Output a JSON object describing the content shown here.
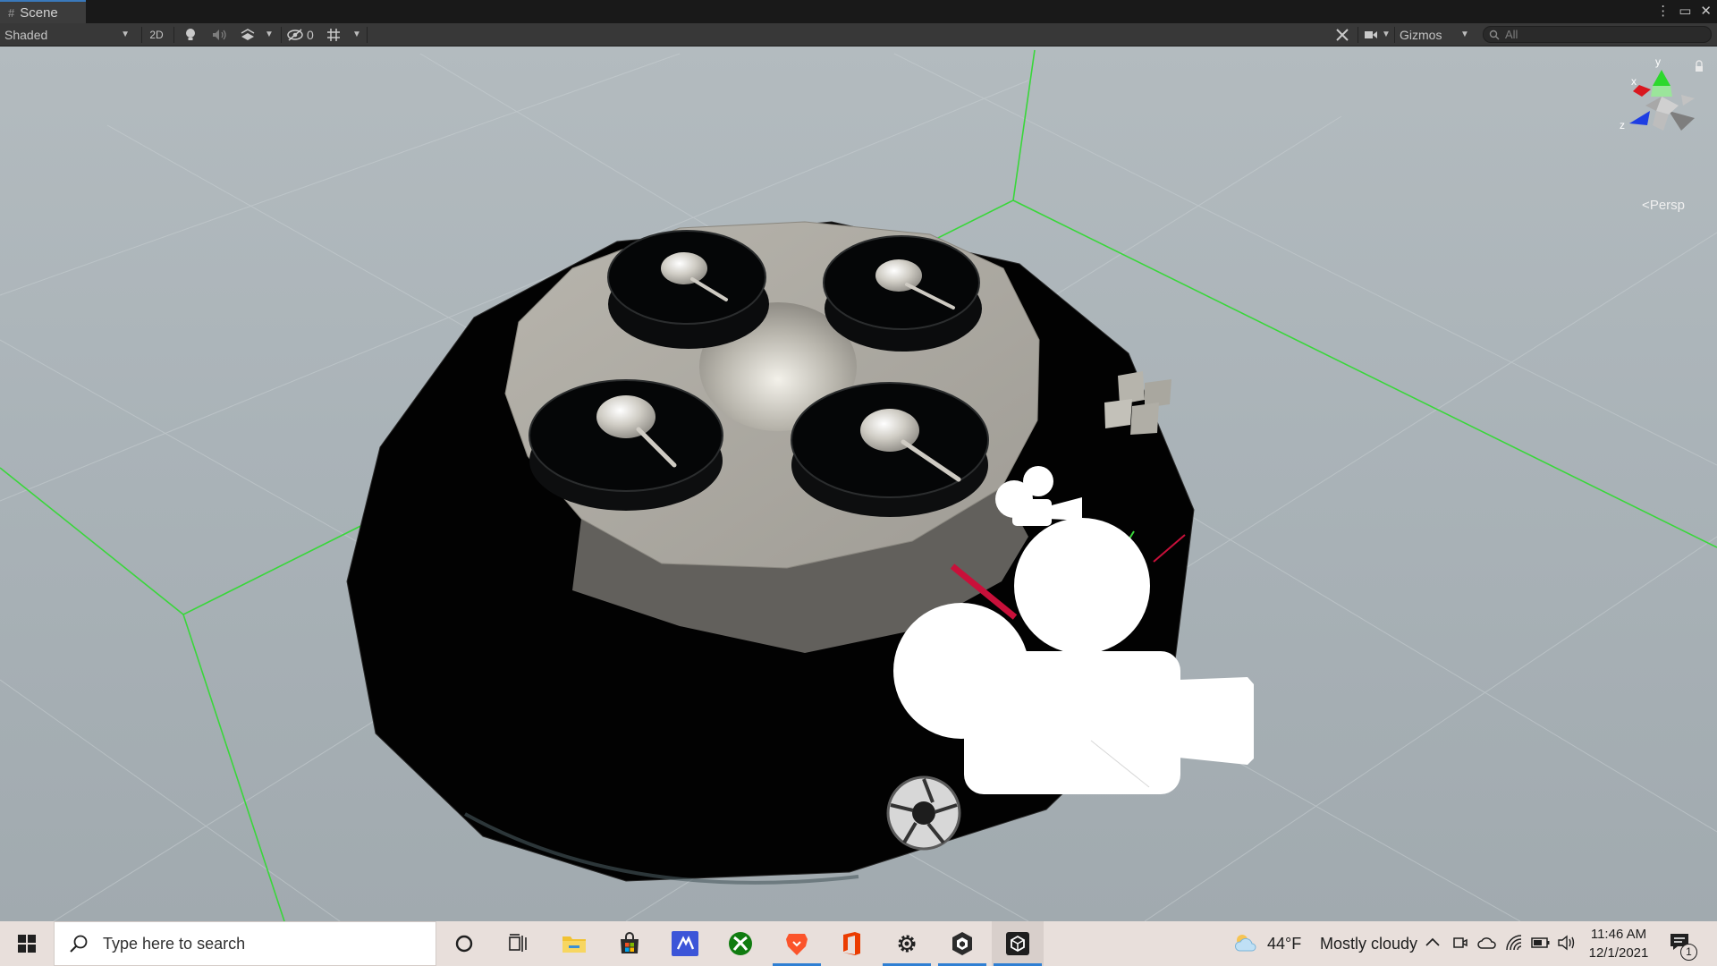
{
  "window": {
    "tab_label": "Scene",
    "controls": [
      "more-icon",
      "maximize-icon",
      "close-icon"
    ]
  },
  "toolbar": {
    "shading_mode": "Shaded",
    "mode_2d": "2D",
    "hidden_count": "0",
    "gizmos_label": "Gizmos",
    "search_placeholder": "All"
  },
  "scene_gizmo": {
    "axis_x": "x",
    "axis_y": "y",
    "axis_z": "z",
    "projection": "Persp",
    "projection_prefix": "<"
  },
  "taskbar": {
    "search_placeholder": "Type here to search",
    "apps": [
      {
        "name": "cortana-icon",
        "running": false
      },
      {
        "name": "task-view-icon",
        "running": false
      },
      {
        "name": "file-explorer-icon",
        "running": false
      },
      {
        "name": "microsoft-store-icon",
        "running": false
      },
      {
        "name": "visual-studio-icon",
        "running": false
      },
      {
        "name": "xbox-icon",
        "running": false
      },
      {
        "name": "brave-browser-icon",
        "running": true
      },
      {
        "name": "office-icon",
        "running": false
      },
      {
        "name": "settings-icon",
        "running": true
      },
      {
        "name": "unity-hub-icon",
        "running": true
      },
      {
        "name": "unity-editor-icon",
        "running": true
      }
    ],
    "weather_temp": "44°F",
    "weather_desc": "Mostly cloudy",
    "time": "11:46 AM",
    "date": "12/1/2021",
    "notification_count": "1"
  },
  "colors": {
    "grid_axis_green": "#3adc3a",
    "selection_red": "#c8103a",
    "unity_dark": "#383838",
    "taskbar_bg": "#e8dfdb",
    "accent_blue": "#2f7fd3"
  }
}
